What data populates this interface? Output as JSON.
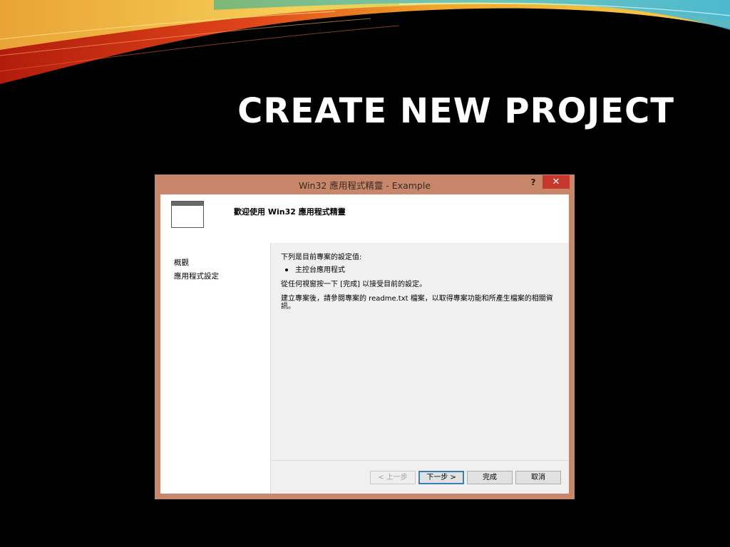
{
  "slide": {
    "title": "CREATE NEW PROJECT"
  },
  "dialog": {
    "title": "Win32 應用程式精靈 - Example",
    "help_label": "?",
    "close_label": "✕",
    "header_title": "歡迎使用 Win32 應用程式精靈",
    "sidebar": {
      "items": [
        {
          "label": "概觀"
        },
        {
          "label": "應用程式設定"
        }
      ]
    },
    "content": {
      "settings_intro": "下列是目前專案的設定值:",
      "bullet_item": "主控台應用程式",
      "finish_hint": "從任何視窗按一下 [完成] 以接受目前的設定。",
      "readme_note": "建立專案後，請參閱專案的 readme.txt 檔案，以取得專案功能和所產生檔案的相關資訊。"
    },
    "buttons": {
      "back": "< 上一步",
      "next": "下一步 >",
      "finish": "完成",
      "cancel": "取消"
    }
  },
  "colors": {
    "background": "#000000",
    "window_frame": "#c8876a",
    "close_button": "#c7372c"
  },
  "icons": {
    "window": "app-window-icon",
    "close": "close-icon",
    "help": "help-icon"
  }
}
